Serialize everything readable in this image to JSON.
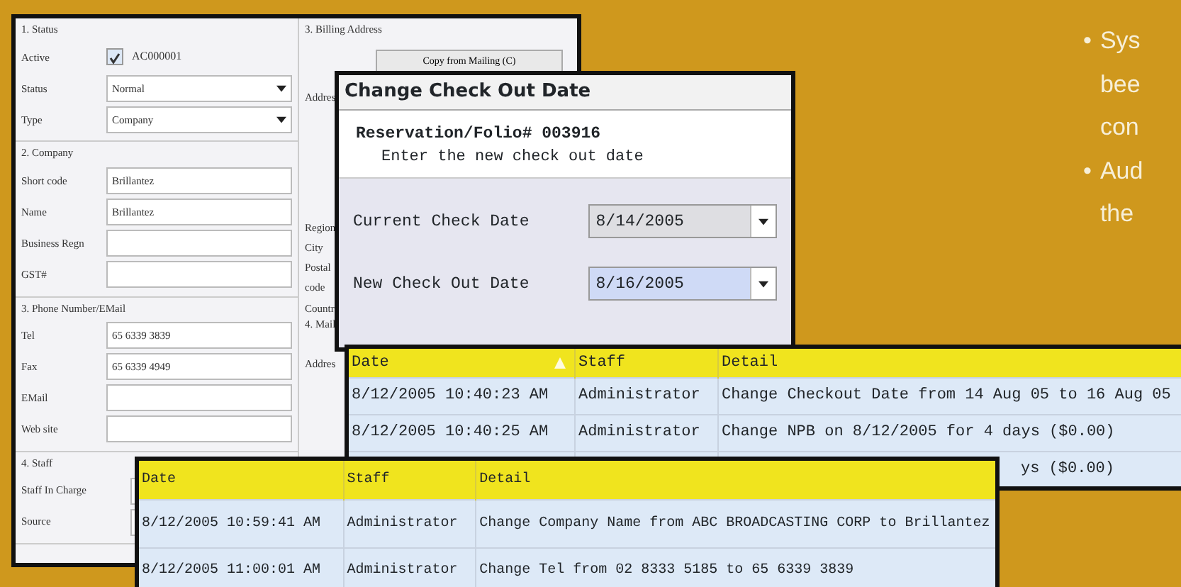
{
  "slide": {
    "bullets": [
      {
        "marker": "•",
        "lines": [
          "Sys",
          "bee",
          "con"
        ]
      },
      {
        "marker": "•",
        "lines": [
          "Aud",
          "the"
        ]
      }
    ]
  },
  "customer_form": {
    "left_sections": [
      {
        "title": "1. Status",
        "fields": [
          {
            "label": "Active",
            "kind": "checkbox",
            "checked": true,
            "value": "AC000001"
          },
          {
            "label": "Status",
            "kind": "select",
            "value": "Normal"
          },
          {
            "label": "Type",
            "kind": "select",
            "value": "Company"
          }
        ]
      },
      {
        "title": "2. Company",
        "fields": [
          {
            "label": "Short code",
            "kind": "text",
            "value": "Brillantez"
          },
          {
            "label": "Name",
            "kind": "text",
            "value": "Brillantez"
          },
          {
            "label": "Business Regn",
            "kind": "text"
          },
          {
            "label": "GST#",
            "kind": "text"
          }
        ]
      },
      {
        "title": "3. Phone Number/EMail",
        "fields": [
          {
            "label": "Tel",
            "kind": "text",
            "value": "65 6339 3839"
          },
          {
            "label": "Fax",
            "kind": "text",
            "value": "65 6339 4949"
          },
          {
            "label": "EMail",
            "kind": "text"
          },
          {
            "label": "Web site",
            "kind": "text"
          }
        ]
      },
      {
        "title": "4. Staff",
        "fields": [
          {
            "label": "Staff In Charge",
            "kind": "edge"
          },
          {
            "label": "Source",
            "kind": "edge"
          }
        ]
      }
    ],
    "right_sections": [
      {
        "title": "3. Billing Address",
        "button": "Copy from Mailing (C)",
        "labels": [
          "Addres",
          "Region",
          "City",
          "Postal",
          "code",
          "Countr"
        ]
      },
      {
        "title": "4. Mail",
        "labels": [
          "Addres"
        ]
      }
    ]
  },
  "dialog": {
    "title": "Change Check Out Date",
    "heading": "Reservation/Folio# 003916",
    "instruction": "Enter the new check out date",
    "fields": [
      {
        "label": "Current Check Date",
        "value": "8/14/2005",
        "selected": false
      },
      {
        "label": "New Check Out Date",
        "value": "8/16/2005",
        "selected": true
      }
    ]
  },
  "audit_table": {
    "columns": [
      "Date",
      "Staff",
      "Detail"
    ],
    "rows": [
      [
        "8/12/2005 10:40:23 AM",
        "Administrator",
        "Change Checkout Date from 14 Aug 05 to 16 Aug 05"
      ],
      [
        "8/12/2005 10:40:25 AM",
        "Administrator",
        "Change NPB on 8/12/2005 for 4 days ($0.00)"
      ]
    ],
    "partial_row_detail": "ys ($0.00)"
  },
  "audit_table_2": {
    "columns": [
      "Date",
      "Staff",
      "Detail"
    ],
    "rows": [
      [
        "8/12/2005 10:59:41 AM",
        "Administrator",
        "Change Company Name from ABC BROADCASTING CORP to Brillantez"
      ],
      [
        "8/12/2005 11:00:01 AM",
        "Administrator",
        "Change Tel from 02 8333 5185 to 65 6339 3839"
      ]
    ]
  }
}
